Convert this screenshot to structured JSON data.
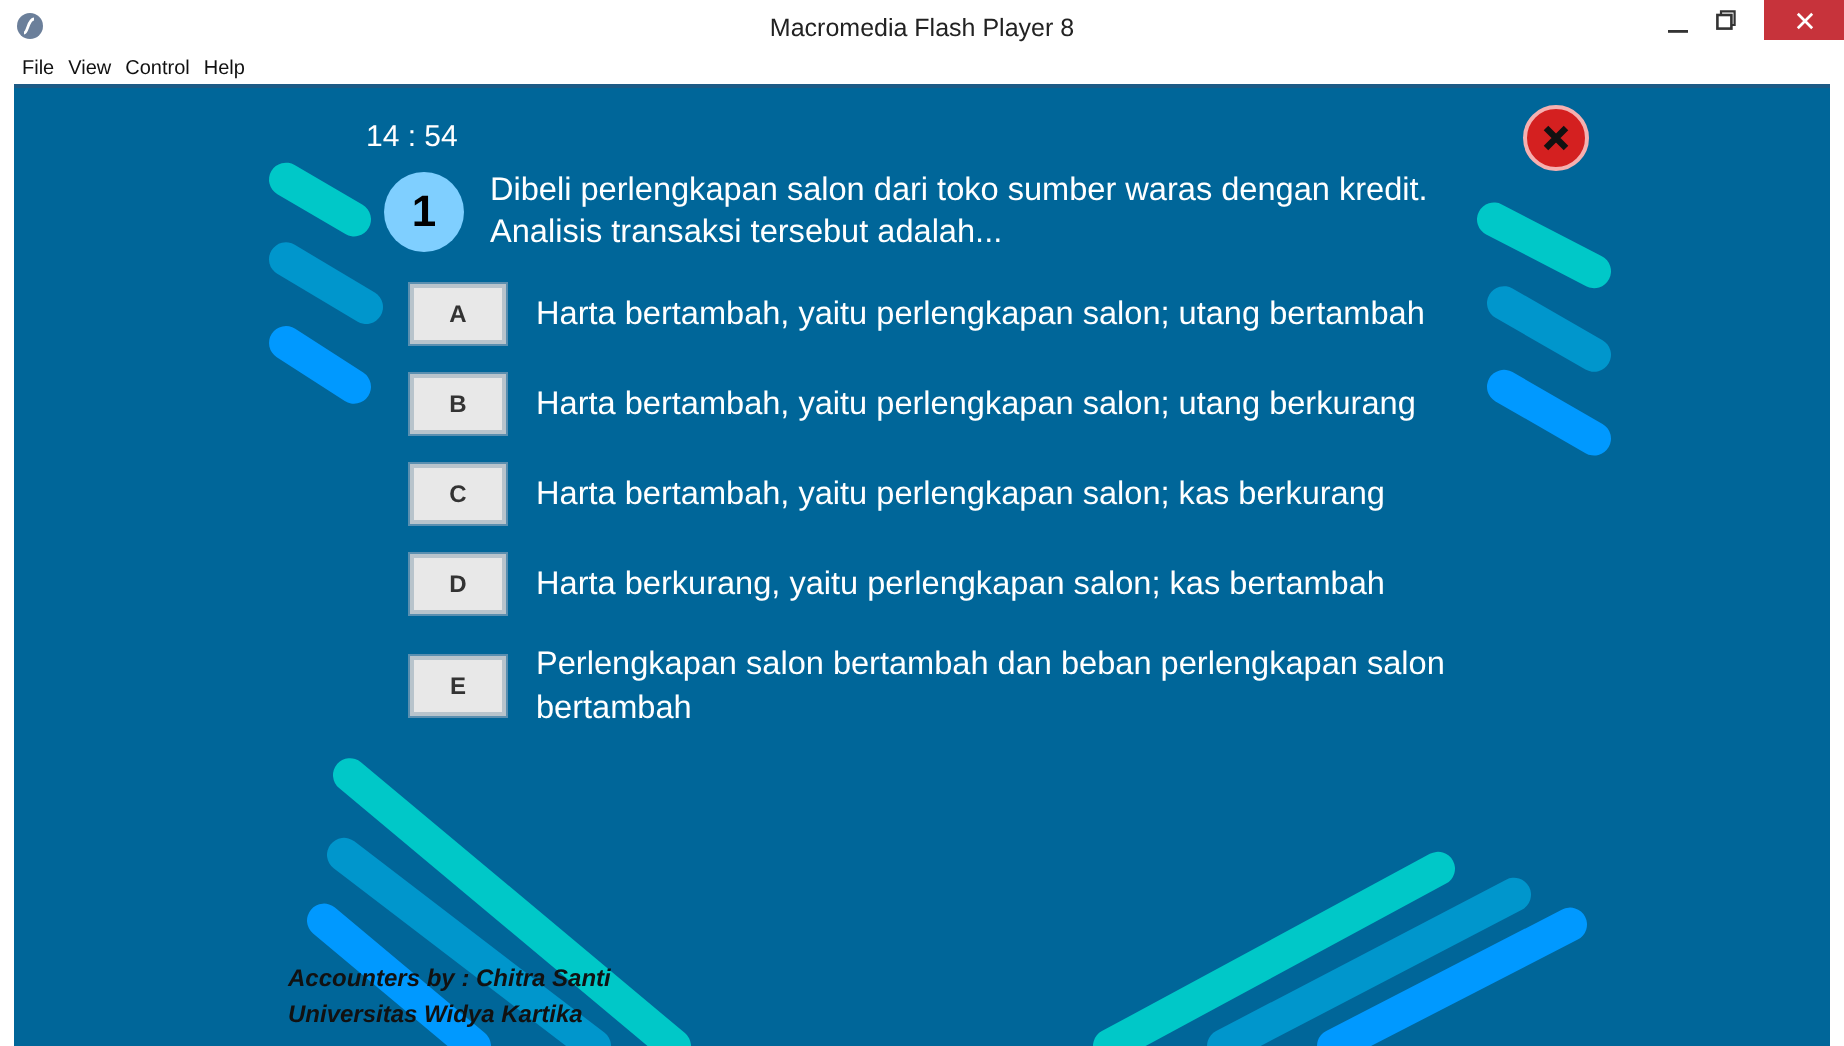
{
  "window": {
    "title": "Macromedia Flash Player 8"
  },
  "menu": [
    "File",
    "View",
    "Control",
    "Help"
  ],
  "timer": "14 : 54",
  "question": {
    "number": "1",
    "text": "Dibeli perlengkapan salon dari toko sumber waras dengan kredit. Analisis transaksi tersebut adalah..."
  },
  "options": [
    {
      "letter": "A",
      "text": "Harta bertambah, yaitu perlengkapan salon; utang bertambah"
    },
    {
      "letter": "B",
      "text": "Harta bertambah, yaitu perlengkapan salon; utang berkurang"
    },
    {
      "letter": "C",
      "text": "Harta bertambah, yaitu perlengkapan salon; kas berkurang"
    },
    {
      "letter": "D",
      "text": "Harta berkurang, yaitu perlengkapan salon; kas bertambah"
    },
    {
      "letter": "E",
      "text": "Perlengkapan salon bertambah dan beban perlengkapan salon bertambah"
    }
  ],
  "credits": [
    "Accounters by : Chitra Santi",
    "Universitas Widya Kartika"
  ]
}
